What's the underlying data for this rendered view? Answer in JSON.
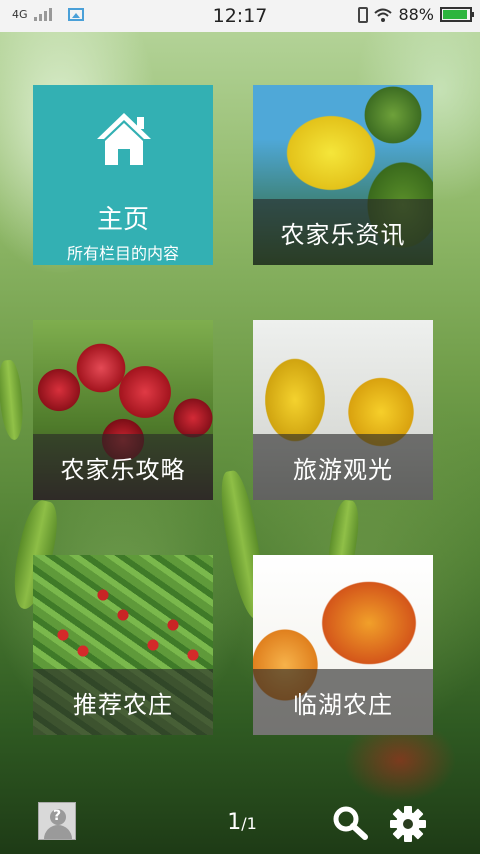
{
  "status_bar": {
    "network": "4G",
    "time": "12:17",
    "battery": "88%",
    "battery_level": 0.88
  },
  "tiles": [
    {
      "id": "home",
      "title": "主页",
      "subtitle": "所有栏目的内容",
      "icon": "house-icon",
      "color": "#33b0b3"
    },
    {
      "id": "news",
      "label": "农家乐资讯",
      "image": "lemons-image"
    },
    {
      "id": "guide",
      "label": "农家乐攻略",
      "image": "hawthorn-berries-image"
    },
    {
      "id": "tour",
      "label": "旅游观光",
      "image": "lemons-image"
    },
    {
      "id": "recommended",
      "label": "推荐农庄",
      "image": "fruit-tree-image"
    },
    {
      "id": "lakeside",
      "label": "临湖农庄",
      "image": "apricots-image"
    }
  ],
  "bottom_bar": {
    "page_current": "1",
    "page_total": "/1",
    "icons": [
      "avatar-icon",
      "search-icon",
      "gear-icon"
    ]
  }
}
